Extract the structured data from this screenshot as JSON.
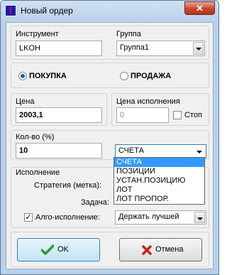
{
  "window": {
    "title": "Новый ордер",
    "close_glyph": "✕"
  },
  "instrument": {
    "label": "Инструмент",
    "value": "LKOH"
  },
  "group": {
    "label": "Группа",
    "value": "Группа1"
  },
  "side": {
    "buy_label": "ПОКУПКА",
    "sell_label": "ПРОДАЖА",
    "selected": "buy"
  },
  "price": {
    "label": "Цена",
    "value": "2003,1"
  },
  "exec_price": {
    "label": "Цена исполнения",
    "value": "0",
    "stop_label": "Стоп",
    "stop_checked": false
  },
  "qty": {
    "label": "Кол-во (%)",
    "value": "10"
  },
  "qty_type": {
    "selected": "СЧЕТА",
    "options": [
      "СЧЕТА",
      "ПОЗИЦИИ",
      "УСТАН.ПОЗИЦИЮ",
      "ЛОТ",
      "ЛОТ ПРОПОР."
    ]
  },
  "execution": {
    "label": "Исполнение",
    "strategy_label": "Стратегия (метка):",
    "task_label": "Задача:",
    "algo_label": "Алго-исполнение:",
    "algo_checked": true,
    "algo_value": "Держать лучшей"
  },
  "buttons": {
    "ok": "OK",
    "cancel": "Отмена"
  },
  "colors": {
    "accent": "#3399ff",
    "ok_icon": "#2a9d2a",
    "cancel_icon": "#c0281c"
  }
}
